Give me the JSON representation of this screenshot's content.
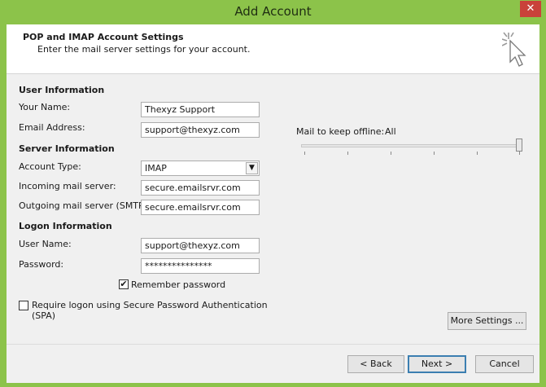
{
  "window": {
    "title": "Add Account",
    "close_glyph": "✕"
  },
  "header": {
    "title": "POP and IMAP Account Settings",
    "subtitle": "Enter the mail server settings for your account.",
    "icon": "cursor-click-icon"
  },
  "user_info": {
    "section_label": "User Information",
    "name_label": "Your Name:",
    "name_value": "Thexyz Support",
    "email_label": "Email Address:",
    "email_value": "support@thexyz.com"
  },
  "server_info": {
    "section_label": "Server Information",
    "account_type_label": "Account Type:",
    "account_type_value": "IMAP",
    "incoming_label": "Incoming mail server:",
    "incoming_value": "secure.emailsrvr.com",
    "outgoing_label": "Outgoing mail server (SMTP):",
    "outgoing_value": "secure.emailsrvr.com"
  },
  "logon_info": {
    "section_label": "Logon Information",
    "username_label": "User Name:",
    "username_value": "support@thexyz.com",
    "password_label": "Password:",
    "password_value": "***************",
    "remember_label": "Remember password",
    "remember_checked": true,
    "spa_label_line1": "Require logon using Secure Password Authentication",
    "spa_label_line2": "(SPA)",
    "spa_checked": false
  },
  "offline": {
    "label": "Mail to keep offline:",
    "value": "All",
    "slider_level": 1.0
  },
  "buttons": {
    "more_settings": "More Settings ...",
    "back": "< Back",
    "next": "Next >",
    "cancel": "Cancel"
  },
  "colors": {
    "titlebar": "#8cc34a",
    "close": "#c9413a",
    "default_button_border": "#3c7fb1"
  }
}
